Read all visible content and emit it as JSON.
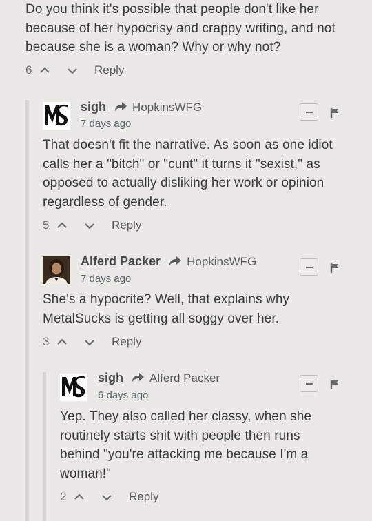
{
  "top_comment": {
    "text": "Do you think it's possible that people don't like her because of her hypocrisy and crappy writing, and not because she is a woman? Why or why not?",
    "votes": "6",
    "reply_label": "Reply"
  },
  "comments": [
    {
      "author": "sigh",
      "parent": "HopkinsWFG",
      "time": "7 days ago",
      "text": "That doesn't fit the narrative. As soon as one idiot calls her a \"bitch\" or \"cunt\" it turns it \"sexist,\" as opposed to actually disliking her work or opinion regardless of gender.",
      "votes": "5",
      "reply_label": "Reply",
      "avatar_icon": "metalsucks-logo"
    },
    {
      "author": "Alferd Packer",
      "parent": "HopkinsWFG",
      "time": "7 days ago",
      "text": "She's a hypocrite? Well, that explains why MetalSucks is getting all soggy over her.",
      "votes": "3",
      "reply_label": "Reply",
      "avatar_icon": "user-photo"
    },
    {
      "author": "sigh",
      "parent": "Alferd Packer",
      "time": "6 days ago",
      "text": "Yep. They also called her classy, when she routinely starts shit with people then runs behind \"you're attacking me because I'm a woman!\"",
      "votes": "2",
      "reply_label": "Reply",
      "avatar_icon": "metalsucks-logo"
    }
  ],
  "colors": {
    "background": "#ebe9e5",
    "time_link": "#5a6670",
    "thread_rule": "#d6d4d0"
  }
}
